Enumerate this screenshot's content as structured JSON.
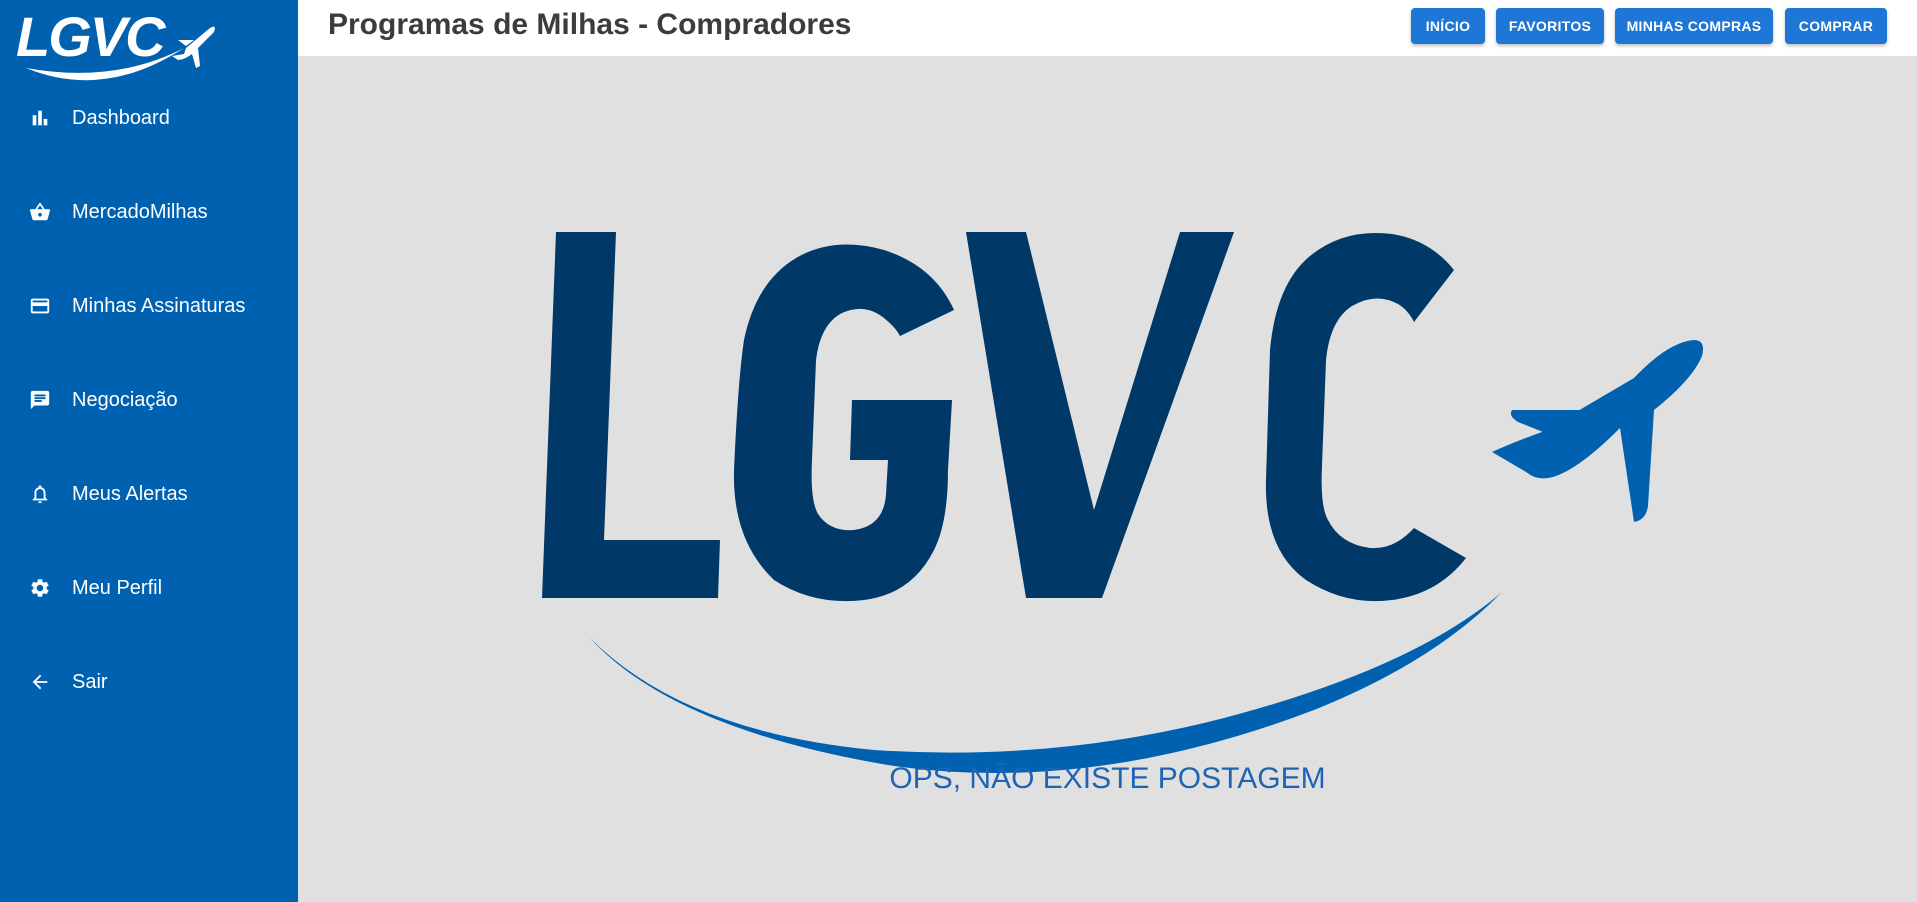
{
  "brand": {
    "logo_text": "LGVC",
    "primary_color": "#0061b0",
    "dark_color": "#003868",
    "accent_color": "#1e77d6"
  },
  "header": {
    "title": "Programas de Milhas - Compradores"
  },
  "topnav": {
    "buttons": [
      {
        "label": "INÍCIO"
      },
      {
        "label": "FAVORITOS"
      },
      {
        "label": "MINHAS COMPRAS"
      },
      {
        "label": "COMPRAR"
      }
    ]
  },
  "sidebar": {
    "items": [
      {
        "label": "Dashboard",
        "icon": "bar-chart-icon"
      },
      {
        "label": "MercadoMilhas",
        "icon": "basket-icon"
      },
      {
        "label": "Minhas Assinaturas",
        "icon": "credit-card-icon"
      },
      {
        "label": "Negociação",
        "icon": "chat-icon"
      },
      {
        "label": "Meus Alertas",
        "icon": "bell-icon"
      },
      {
        "label": "Meu Perfil",
        "icon": "gear-icon"
      },
      {
        "label": "Sair",
        "icon": "arrow-left-icon"
      }
    ]
  },
  "main": {
    "empty_message": "OPS, NÃO EXISTE POSTAGEM"
  }
}
